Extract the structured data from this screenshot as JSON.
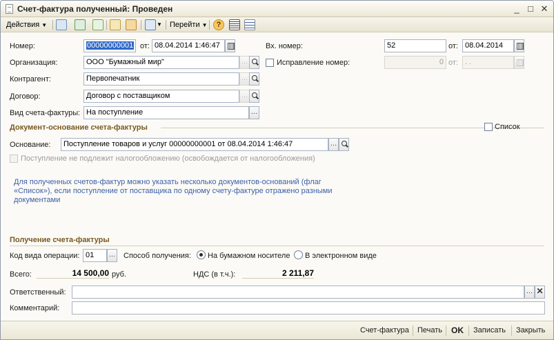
{
  "window": {
    "title": "Счет-фактура полученный: Проведен",
    "controls": [
      "_",
      "□",
      "✕"
    ]
  },
  "toolbar": {
    "actions_label": "Действия",
    "goto_label": "Перейти"
  },
  "form": {
    "number_label": "Номер:",
    "number_value": "00000000001",
    "from_label": "от:",
    "date_value": "08.04.2014 1:46:47",
    "in_number_label": "Вх. номер:",
    "in_number_value": "52",
    "in_from_label": "от:",
    "in_date_value": "08.04.2014",
    "org_label": "Организация:",
    "org_value": "ООО \"Бумажный мир\"",
    "correction_label": "Исправление номер:",
    "correction_value": "0",
    "correction_from_label": "от:",
    "correction_date_value": ". .",
    "counterparty_label": "Контрагент:",
    "counterparty_value": "Первопечатник",
    "contract_label": "Договор:",
    "contract_value": "Договор с поставщиком",
    "invoice_type_label": "Вид счета-фактуры:",
    "invoice_type_value": "На поступление"
  },
  "basis": {
    "section_title": "Документ-основание счета-фактуры",
    "list_label": "Список",
    "basis_label": "Основание:",
    "basis_value": "Поступление товаров и услуг 00000000001 от 08.04.2014 1:46:47",
    "not_taxable_label": "Поступление не подлежит налогообложению (освобождается от налогообложения)",
    "info_text": "Для полученных счетов-фактур можно указать несколько документов-оснований (флаг «Список»), если поступление от поставщика по одному счету-фактуре отражено разными документами"
  },
  "receipt": {
    "section_title": "Получение счета-фактуры",
    "op_code_label": "Код вида операции:",
    "op_code_value": "01",
    "method_label": "Способ получения:",
    "paper_label": "На бумажном носителе",
    "electronic_label": "В электронном виде"
  },
  "totals": {
    "total_label": "Всего:",
    "total_value": "14 500,00",
    "currency": "руб.",
    "vat_label": "НДС (в т.ч.):",
    "vat_value": "2 211,87"
  },
  "footer_fields": {
    "responsible_label": "Ответственный:",
    "responsible_value": "",
    "comment_label": "Комментарий:",
    "comment_value": ""
  },
  "bottom_buttons": {
    "invoice": "Счет-фактура",
    "print": "Печать",
    "ok": "OK",
    "save": "Записать",
    "close": "Закрыть"
  },
  "colors": {
    "section_title": "#7a5a20",
    "info_text": "#3c5fa8",
    "selection": "#3169c6"
  }
}
